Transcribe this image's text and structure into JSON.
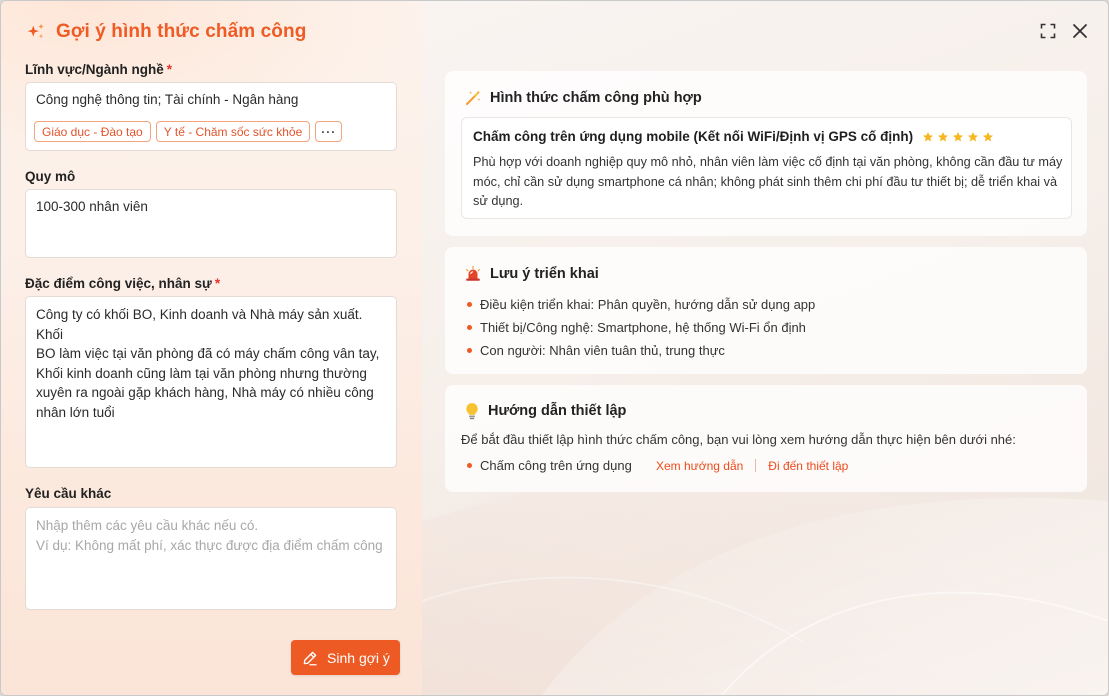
{
  "dialog": {
    "title": "Gợi ý hình thức chấm công"
  },
  "form": {
    "industry": {
      "label": "Lĩnh vực/Ngành nghề",
      "required_mark": "*",
      "value": "Công nghệ thông tin; Tài chính - Ngân hàng",
      "tags": [
        "Giáo dục - Đào tạo",
        "Y tế - Chăm sốc sức khỏe"
      ],
      "more_label": "···"
    },
    "scale": {
      "label": "Quy mô",
      "value": "100-300 nhân viên"
    },
    "job": {
      "label": "Đặc điểm công việc, nhân sự",
      "required_mark": "*",
      "value": "Công ty có khối BO, Kinh doanh và Nhà máy sản xuất. Khối\nBO làm việc tại văn phòng đã có máy chấm công vân tay,\nKhối kinh doanh cũng làm tại văn phòng nhưng thường\nxuyên ra ngoài gặp khách hàng, Nhà máy có nhiều công\nnhân lớn tuổi"
    },
    "other": {
      "label": "Yêu cầu khác",
      "placeholder": "Nhập thêm các yêu cầu khác nếu có.\nVí dụ: Không mất phí, xác thực được địa điểm chấm công"
    },
    "generate_label": "Sinh gợi ý"
  },
  "results": {
    "method": {
      "heading": "Hình thức chấm công phù hợp",
      "option_title": "Chấm công trên ứng dụng mobile (Kết nối WiFi/Định vị GPS cố định)",
      "rating": 5,
      "description": "Phù hợp với doanh nghiệp quy mô nhỏ, nhân viên làm việc cố định tại văn phòng, không cần đầu tư máy móc, chỉ cần sử dụng smartphone cá nhân; không phát sinh thêm chi phí đầu tư thiết bị; dễ triển khai và sử dụng."
    },
    "notes": {
      "heading": "Lưu ý triển khai",
      "items": [
        "Điều kiện triển khai: Phân quyền, hướng dẫn sử dụng app",
        "Thiết bị/Công nghệ: Smartphone, hệ thống Wi-Fi ổn định",
        "Con người: Nhân viên tuân thủ, trung thực"
      ]
    },
    "guide": {
      "heading": "Hướng dẫn thiết lập",
      "intro": "Để bắt đầu thiết lập hình thức chấm công, bạn vui lòng xem hướng dẫn thực hiện bên dưới nhé:",
      "item": "Chấm công trên ứng dụng",
      "view_link": "Xem hướng dẫn",
      "go_link": "Đi đến thiết lập"
    }
  },
  "colors": {
    "accent": "#ee5a24",
    "required": "#e5322d",
    "star": "#f5b820"
  },
  "icons": [
    "sparkle-icon",
    "expand-icon",
    "close-icon",
    "magic-wand-icon",
    "star-icon",
    "siren-icon",
    "lightbulb-icon",
    "pencil-icon"
  ]
}
